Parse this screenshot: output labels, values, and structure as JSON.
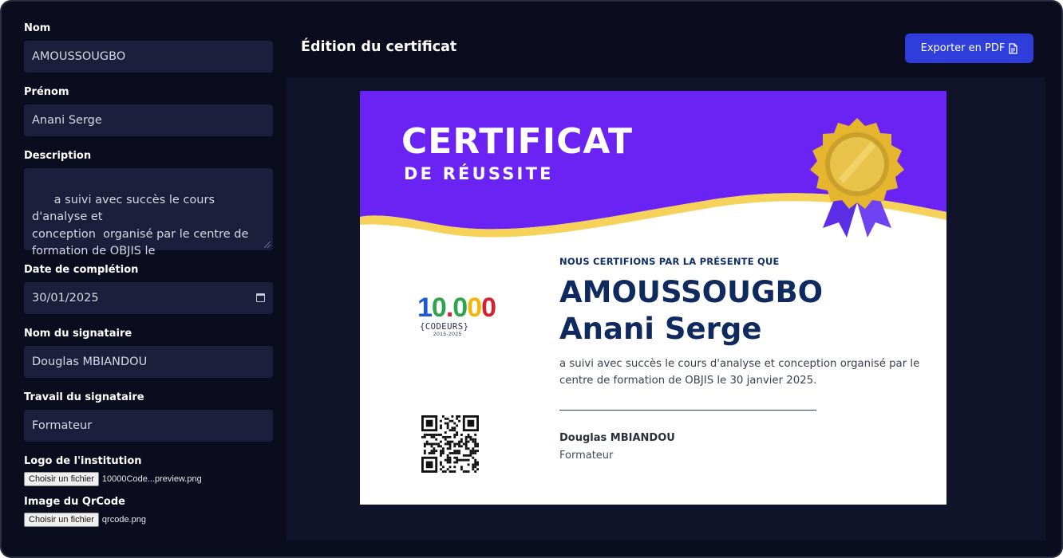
{
  "form": {
    "nom": {
      "label": "Nom",
      "value": "AMOUSSOUGBO"
    },
    "prenom": {
      "label": "Prénom",
      "value": "Anani Serge"
    },
    "description": {
      "label": "Description",
      "value": "a suivi avec succès le cours d'analyse et\nconception  organisé par le centre de\nformation de OBJIS le"
    },
    "date": {
      "label": "Date de complétion",
      "value": "30/01/2025"
    },
    "signataire": {
      "label": "Nom du signataire",
      "value": "Douglas MBIANDOU"
    },
    "travail": {
      "label": "Travail du signataire",
      "value": "Formateur"
    },
    "logo": {
      "label": "Logo de l'institution",
      "button": "Choisir un fichier",
      "file": "10000Code...preview.png"
    },
    "qrcode": {
      "label": "Image du QrCode",
      "button": "Choisir un fichier",
      "file": "qrcode.png"
    }
  },
  "header": {
    "title": "Édition du certificat",
    "export_label": "Exporter en PDF"
  },
  "certificate": {
    "title": "CERTIFICAT",
    "subtitle": "DE RÉUSSITE",
    "kicker": "NOUS CERTIFIONS PAR LA PRÉSENTE QUE",
    "last_name": "AMOUSSOUGBO",
    "first_name": "Anani Serge",
    "description": "a suivi avec succès le cours d'analyse et conception organisé par le centre de formation de OBJIS le 30 janvier 2025.",
    "signer_name": "Douglas MBIANDOU",
    "signer_role": "Formateur",
    "logo": {
      "digits": [
        "1",
        "0",
        ".",
        "0",
        "0",
        "0"
      ],
      "tagline": "{CODEURS}",
      "years": "2015-2025"
    }
  },
  "colors": {
    "page_bg": "#0b0c1d",
    "input_bg": "#1d1e3c",
    "accent_button": "#2f3ddb",
    "cert_banner": "#6a23f2",
    "cert_wave": "#f7d25a",
    "cert_text": "#0f2a5e",
    "logo_digits": [
      "#1d57d6",
      "#2ea44f",
      "#d3212d",
      "#2ea44f",
      "#f2b705",
      "#d3212d"
    ]
  },
  "icons": {
    "export": "document-icon",
    "date": "calendar-icon",
    "badge": "gold-medal-icon",
    "qr": "qr-code-icon"
  }
}
